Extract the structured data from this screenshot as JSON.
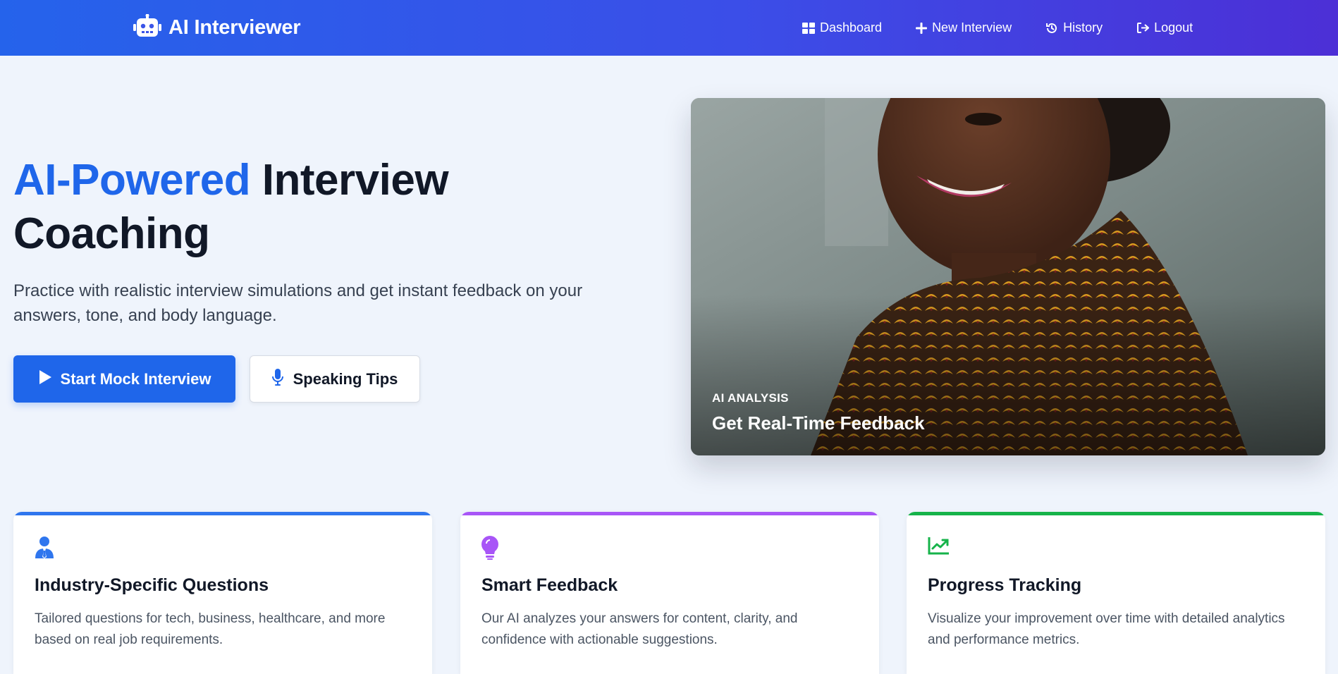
{
  "nav": {
    "brand": "AI Interviewer",
    "links": [
      {
        "label": "Dashboard",
        "icon": "grid-icon"
      },
      {
        "label": "New Interview",
        "icon": "plus-icon"
      },
      {
        "label": "History",
        "icon": "history-icon"
      },
      {
        "label": "Logout",
        "icon": "logout-icon"
      }
    ]
  },
  "hero": {
    "title_accent": "AI-Powered",
    "title_rest_1": "Interview",
    "title_rest_2": "Coaching",
    "subtitle": "Practice with realistic interview simulations and get instant feedback on your answers, tone, and body language.",
    "primary_button": "Start Mock Interview",
    "secondary_button": "Speaking Tips",
    "image_label": "AI ANALYSIS",
    "image_title": "Get Real-Time Feedback"
  },
  "features": [
    {
      "title": "Industry-Specific Questions",
      "description": "Tailored questions for tech, business, healthcare, and more based on real job requirements.",
      "icon": "user-tie-icon",
      "color": "#2f76ee"
    },
    {
      "title": "Smart Feedback",
      "description": "Our AI analyzes your answers for content, clarity, and confidence with actionable suggestions.",
      "icon": "lightbulb-icon",
      "color": "#a855f7"
    },
    {
      "title": "Progress Tracking",
      "description": "Visualize your improvement over time with detailed analytics and performance metrics.",
      "icon": "chart-line-icon",
      "color": "#16b34a"
    }
  ],
  "colors": {
    "accent": "#1f66ea",
    "nav_gradient_start": "#2563eb",
    "nav_gradient_end": "#4c2fd6",
    "background": "#eff4fc"
  }
}
